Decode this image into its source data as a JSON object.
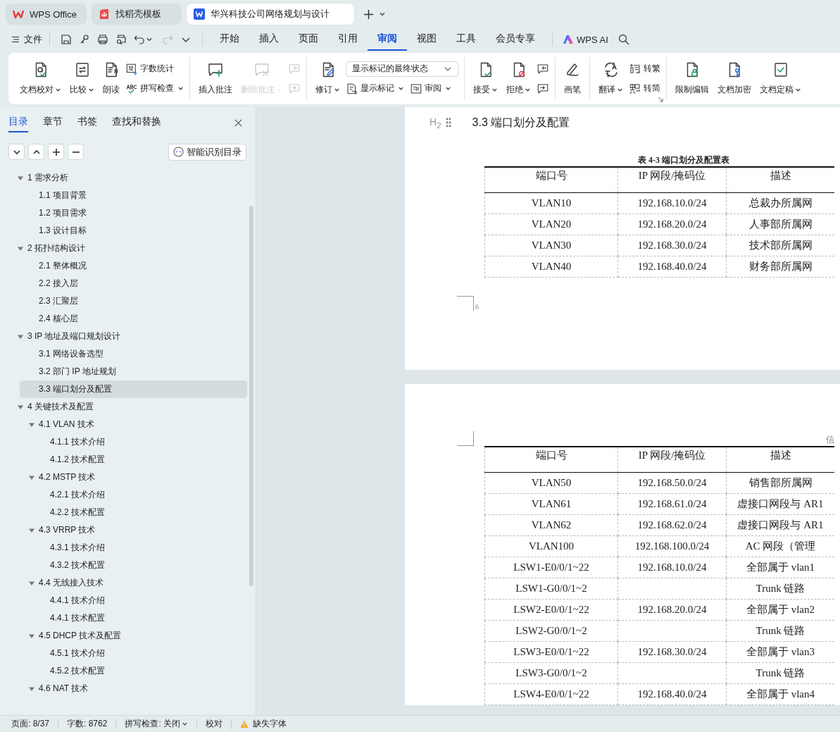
{
  "tab_bar": {
    "tabs": [
      {
        "label": "WPS Office",
        "selected": false
      },
      {
        "label": "找稻壳模板",
        "selected": false
      },
      {
        "label": "华兴科技公司网络规划与设计",
        "selected": true
      }
    ]
  },
  "menu_bar": {
    "file": "文件",
    "tabs": [
      {
        "label": "开始",
        "selected": false
      },
      {
        "label": "插入",
        "selected": false
      },
      {
        "label": "页面",
        "selected": false
      },
      {
        "label": "引用",
        "selected": false
      },
      {
        "label": "审阅",
        "selected": true
      },
      {
        "label": "视图",
        "selected": false
      },
      {
        "label": "工具",
        "selected": false
      },
      {
        "label": "会员专享",
        "selected": false
      }
    ],
    "ai": "WPS AI"
  },
  "ribbon": {
    "groups": [
      {
        "launcher": false,
        "items": [
          {
            "kind": "large",
            "label": "文档校对",
            "dropdown": true,
            "disabled": false
          },
          {
            "kind": "large",
            "label": "比较",
            "dropdown": true,
            "disabled": false
          },
          {
            "kind": "large",
            "label": "朗读",
            "dropdown": false,
            "disabled": false
          },
          {
            "kind": "stack",
            "rows": [
              [
                {
                  "kind": "small",
                  "label": "字数统计",
                  "dropdown": false,
                  "disabled": false
                }
              ],
              [
                {
                  "kind": "small",
                  "label": "拼写检查",
                  "dropdown": true,
                  "disabled": false
                }
              ]
            ]
          }
        ]
      },
      {
        "launcher": false,
        "items": [
          {
            "kind": "large",
            "label": "插入批注",
            "dropdown": false,
            "disabled": false
          },
          {
            "kind": "large",
            "label": "删除批注",
            "dropdown": true,
            "disabled": true
          },
          {
            "kind": "stack",
            "rows": [
              [
                {
                  "kind": "icon",
                  "dropdown": false,
                  "disabled": true
                }
              ],
              [
                {
                  "kind": "icon",
                  "dropdown": false,
                  "disabled": true
                }
              ]
            ]
          }
        ]
      },
      {
        "launcher": false,
        "items": [
          {
            "kind": "large",
            "label": "修订",
            "dropdown": true,
            "disabled": false
          },
          {
            "kind": "stack",
            "rows": [
              [
                {
                  "kind": "select",
                  "value": "显示标记的最终状态",
                  "dropdown": true
                }
              ],
              [
                {
                  "kind": "small",
                  "label": "显示标记",
                  "dropdown": true,
                  "disabled": false
                },
                {
                  "kind": "small",
                  "label": "审阅",
                  "dropdown": true,
                  "disabled": false
                }
              ]
            ]
          }
        ]
      },
      {
        "launcher": false,
        "items": [
          {
            "kind": "large",
            "label": "接受",
            "dropdown": true,
            "disabled": false
          },
          {
            "kind": "large",
            "label": "拒绝",
            "dropdown": true,
            "disabled": false
          },
          {
            "kind": "stack",
            "rows": [
              [
                {
                  "kind": "icon",
                  "dropdown": false,
                  "disabled": false
                }
              ],
              [
                {
                  "kind": "icon",
                  "dropdown": false,
                  "disabled": false
                }
              ]
            ]
          }
        ]
      },
      {
        "launcher": false,
        "items": [
          {
            "kind": "large",
            "label": "画笔",
            "dropdown": false,
            "disabled": false
          }
        ]
      },
      {
        "launcher": true,
        "items": [
          {
            "kind": "large",
            "label": "翻译",
            "dropdown": true,
            "disabled": false
          },
          {
            "kind": "stack",
            "rows": [
              [
                {
                  "kind": "small",
                  "label": "转繁",
                  "dropdown": false,
                  "disabled": false
                }
              ],
              [
                {
                  "kind": "small",
                  "label": "转简",
                  "dropdown": false,
                  "disabled": false
                }
              ]
            ]
          }
        ]
      },
      {
        "launcher": false,
        "items": [
          {
            "kind": "large",
            "label": "限制编辑",
            "dropdown": false,
            "disabled": false
          },
          {
            "kind": "large",
            "label": "文档加密",
            "dropdown": false,
            "disabled": false
          },
          {
            "kind": "large",
            "label": "文档定稿",
            "dropdown": true,
            "disabled": false
          }
        ]
      }
    ]
  },
  "nav_pane": {
    "tabs": [
      {
        "label": "目录",
        "selected": true
      },
      {
        "label": "章节",
        "selected": false
      },
      {
        "label": "书签",
        "selected": false
      },
      {
        "label": "查找和替换",
        "selected": false
      }
    ],
    "smart_button": "智能识别目录",
    "toc": [
      {
        "label": "1  需求分析",
        "expanded": true,
        "selected": false,
        "children": [
          {
            "label": "1.1  项目背景",
            "selected": false
          },
          {
            "label": "1.2  项目需求",
            "selected": false
          },
          {
            "label": "1.3  设计目标",
            "selected": false
          }
        ]
      },
      {
        "label": "2  拓扑结构设计",
        "expanded": true,
        "selected": false,
        "children": [
          {
            "label": "2.1  整体概况",
            "selected": false
          },
          {
            "label": "2.2  接入层",
            "selected": false
          },
          {
            "label": "2.3  汇聚层",
            "selected": false
          },
          {
            "label": "2.4  核心层",
            "selected": false
          }
        ]
      },
      {
        "label": "3 IP 地址及端口规划设计",
        "expanded": true,
        "selected": false,
        "children": [
          {
            "label": "3.1  网络设备选型",
            "selected": false
          },
          {
            "label": "3.2  部门 IP 地址规划",
            "selected": false
          },
          {
            "label": "3.3  端口划分及配置",
            "selected": true
          }
        ]
      },
      {
        "label": "4  关键技术及配置",
        "expanded": true,
        "selected": false,
        "children": [
          {
            "label": "4.1 VLAN 技术",
            "expanded": true,
            "selected": false,
            "children": [
              {
                "label": "4.1.1  技术介绍",
                "selected": false
              },
              {
                "label": "4.1.2  技术配置",
                "selected": false
              }
            ]
          },
          {
            "label": "4.2 MSTP 技术",
            "expanded": true,
            "selected": false,
            "children": [
              {
                "label": "4.2.1  技术介绍",
                "selected": false
              },
              {
                "label": "4.2.2  技术配置",
                "selected": false
              }
            ]
          },
          {
            "label": "4.3 VRRP 技术",
            "expanded": true,
            "selected": false,
            "children": [
              {
                "label": "4.3.1  技术介绍",
                "selected": false
              },
              {
                "label": "4.3.2  技术配置",
                "selected": false
              }
            ]
          },
          {
            "label": "4.4  无线接入技术",
            "expanded": true,
            "selected": false,
            "children": [
              {
                "label": "4.4.1  技术介绍",
                "selected": false
              },
              {
                "label": "4.4.1  技术配置",
                "selected": false
              }
            ]
          },
          {
            "label": "4.5 DHCP 技术及配置",
            "expanded": true,
            "selected": false,
            "children": [
              {
                "label": "4.5.1  技术介绍",
                "selected": false
              },
              {
                "label": "4.5.2  技术配置",
                "selected": false
              }
            ]
          },
          {
            "label": "4.6 NAT 技术",
            "expanded": true,
            "selected": false
          }
        ]
      }
    ]
  },
  "document": {
    "pages": [
      {
        "heading_marker": "H$_{2}$",
        "heading": "3.3  端口划分及配置",
        "caption": "表 4-3  端口划分及配置表",
        "table": {
          "columns": [
            "端口号",
            "IP 网段/掩码位",
            "描述"
          ],
          "rows": [
            {
              "port": "VLAN10",
              "subnet": "192.168.10.0/24",
              "description": "总裁办所属网"
            },
            {
              "port": "VLAN20",
              "subnet": "192.168.20.0/24",
              "description": "人事部所属网"
            },
            {
              "port": "VLAN30",
              "subnet": "192.168.30.0/24",
              "description": "技术部所属网"
            },
            {
              "port": "VLAN40",
              "subnet": "192.168.40.0/24",
              "description": "财务部所属网"
            }
          ]
        },
        "page_number": "6"
      },
      {
        "header": "信",
        "table": {
          "columns": [
            "端口号",
            "IP 网段/掩码位",
            "描述"
          ],
          "rows": [
            {
              "port": "VLAN50",
              "subnet": "192.168.50.0/24",
              "description": "销售部所属网"
            },
            {
              "port": "VLAN61",
              "subnet": "192.168.61.0/24",
              "description": "虚接口网段与 AR1"
            },
            {
              "port": "VLAN62",
              "subnet": "192.168.62.0/24",
              "description": "虚接口网段与 AR1"
            },
            {
              "port": "VLAN100",
              "subnet": "192.168.100.0/24",
              "description": "AC 网段（管理"
            },
            {
              "port": "LSW1-E0/0/1~22",
              "subnet": "192.168.10.0/24",
              "description": "全部属于 vlan1"
            },
            {
              "port": "LSW1-G0/0/1~2",
              "description": "Trunk 链路"
            },
            {
              "port": "LSW2-E0/0/1~22",
              "subnet": "192.168.20.0/24",
              "description": "全部属于 vlan2"
            },
            {
              "port": "LSW2-G0/0/1~2",
              "description": "Trunk 链路"
            },
            {
              "port": "LSW3-E0/0/1~22",
              "subnet": "192.168.30.0/24",
              "description": "全部属于 vlan3"
            },
            {
              "port": "LSW3-G0/0/1~2",
              "description": "Trunk 链路"
            },
            {
              "port": "LSW4-E0/0/1~22",
              "subnet": "192.168.40.0/24",
              "description": "全部属于 vlan4"
            }
          ]
        }
      }
    ]
  },
  "status_bar": {
    "items": [
      {
        "kind": "text",
        "label": "页面: 8/37"
      },
      {
        "kind": "text",
        "label": "字数: 8762"
      },
      {
        "kind": "dropdown",
        "label": "拼写检查: 关闭"
      },
      {
        "kind": "text",
        "label": "校对"
      },
      {
        "kind": "warning",
        "label": "缺失字体"
      }
    ]
  }
}
